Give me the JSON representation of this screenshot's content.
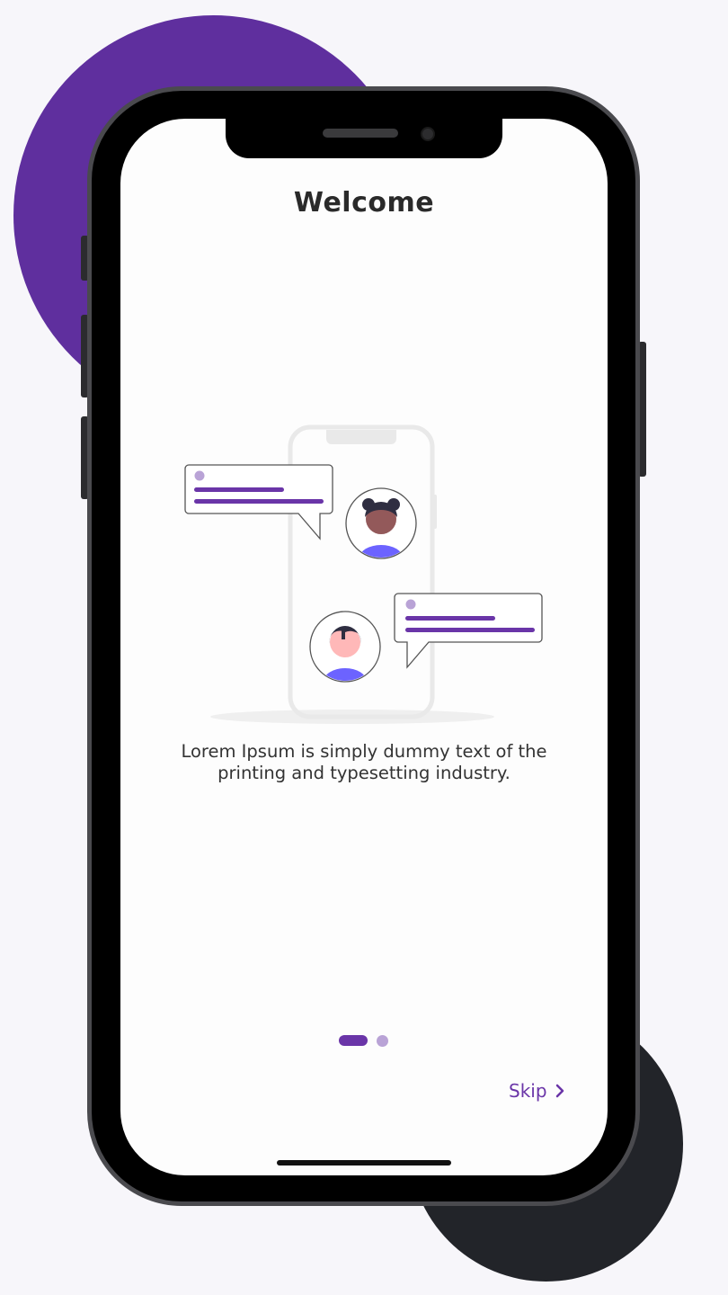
{
  "onboarding": {
    "title": "Welcome",
    "description": "Lorem Ipsum is simply dummy text of the printing and typesetting industry.",
    "skip_label": "Skip",
    "skip_icon": "chevron-right-icon",
    "pagination": {
      "current_page": 1,
      "total_pages": 2
    }
  },
  "colors": {
    "accent": "#6a35a8",
    "accent_light": "#b9a3d6",
    "background_circle_purple": "#5f2f9e",
    "background_circle_dark": "#222429"
  }
}
